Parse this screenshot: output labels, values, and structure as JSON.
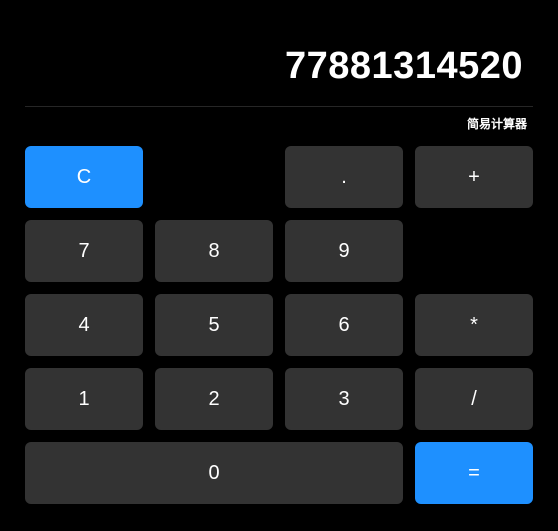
{
  "display": {
    "value": "77881314520"
  },
  "label": "简易计算器",
  "keys": {
    "clear": "C",
    "dot": ".",
    "plus": "+",
    "seven": "7",
    "eight": "8",
    "nine": "9",
    "four": "4",
    "five": "5",
    "six": "6",
    "multiply": "*",
    "one": "1",
    "two": "2",
    "three": "3",
    "divide": "/",
    "zero": "0",
    "equals": "="
  }
}
